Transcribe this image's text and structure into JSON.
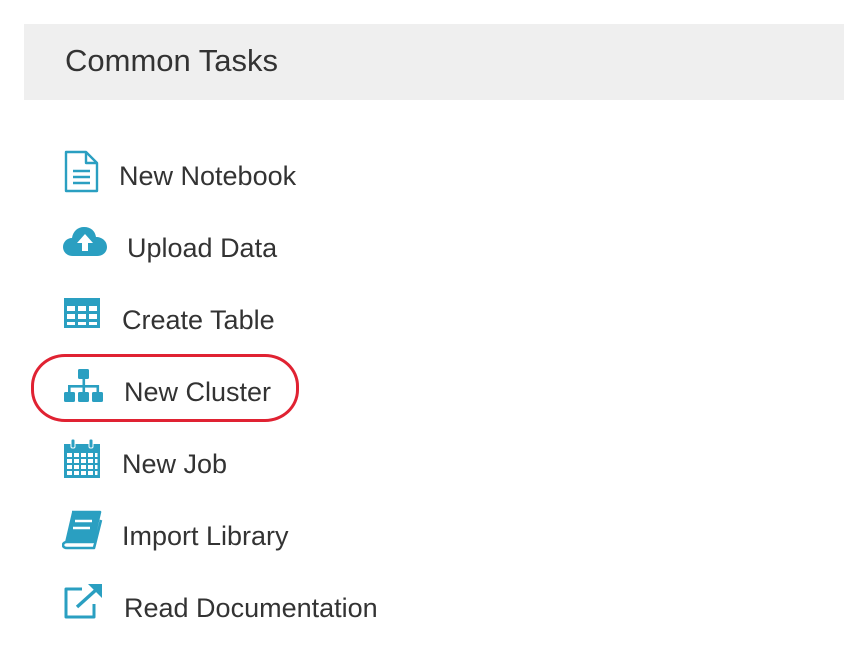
{
  "header": {
    "title": "Common Tasks"
  },
  "tasks": [
    {
      "id": "new-notebook",
      "label": "New Notebook",
      "icon": "notebook-icon"
    },
    {
      "id": "upload-data",
      "label": "Upload Data",
      "icon": "cloud-upload-icon"
    },
    {
      "id": "create-table",
      "label": "Create Table",
      "icon": "table-icon"
    },
    {
      "id": "new-cluster",
      "label": "New Cluster",
      "icon": "cluster-icon",
      "highlighted": true
    },
    {
      "id": "new-job",
      "label": "New Job",
      "icon": "calendar-icon"
    },
    {
      "id": "import-library",
      "label": "Import Library",
      "icon": "book-icon"
    },
    {
      "id": "read-documentation",
      "label": "Read Documentation",
      "icon": "external-link-icon"
    }
  ],
  "colors": {
    "icon": "#2a9fc1",
    "highlight": "#e02232",
    "header_bg": "#efefef",
    "text": "#333333"
  }
}
